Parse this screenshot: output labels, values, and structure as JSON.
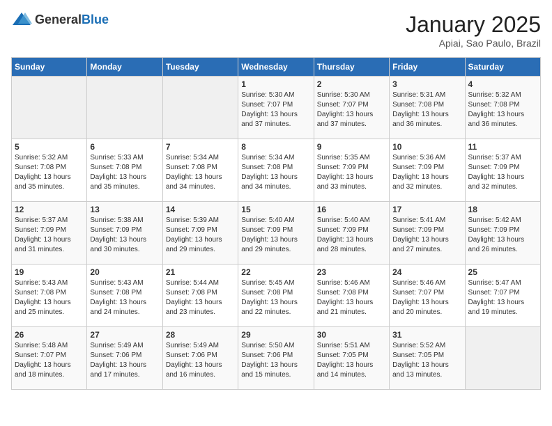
{
  "header": {
    "logo_general": "General",
    "logo_blue": "Blue",
    "title": "January 2025",
    "subtitle": "Apiai, Sao Paulo, Brazil"
  },
  "calendar": {
    "days_of_week": [
      "Sunday",
      "Monday",
      "Tuesday",
      "Wednesday",
      "Thursday",
      "Friday",
      "Saturday"
    ],
    "weeks": [
      [
        {
          "day": null,
          "sunrise": null,
          "sunset": null,
          "daylight": null
        },
        {
          "day": null,
          "sunrise": null,
          "sunset": null,
          "daylight": null
        },
        {
          "day": null,
          "sunrise": null,
          "sunset": null,
          "daylight": null
        },
        {
          "day": "1",
          "sunrise": "5:30 AM",
          "sunset": "7:07 PM",
          "daylight": "13 hours and 37 minutes."
        },
        {
          "day": "2",
          "sunrise": "5:30 AM",
          "sunset": "7:07 PM",
          "daylight": "13 hours and 37 minutes."
        },
        {
          "day": "3",
          "sunrise": "5:31 AM",
          "sunset": "7:08 PM",
          "daylight": "13 hours and 36 minutes."
        },
        {
          "day": "4",
          "sunrise": "5:32 AM",
          "sunset": "7:08 PM",
          "daylight": "13 hours and 36 minutes."
        }
      ],
      [
        {
          "day": "5",
          "sunrise": "5:32 AM",
          "sunset": "7:08 PM",
          "daylight": "13 hours and 35 minutes."
        },
        {
          "day": "6",
          "sunrise": "5:33 AM",
          "sunset": "7:08 PM",
          "daylight": "13 hours and 35 minutes."
        },
        {
          "day": "7",
          "sunrise": "5:34 AM",
          "sunset": "7:08 PM",
          "daylight": "13 hours and 34 minutes."
        },
        {
          "day": "8",
          "sunrise": "5:34 AM",
          "sunset": "7:08 PM",
          "daylight": "13 hours and 34 minutes."
        },
        {
          "day": "9",
          "sunrise": "5:35 AM",
          "sunset": "7:09 PM",
          "daylight": "13 hours and 33 minutes."
        },
        {
          "day": "10",
          "sunrise": "5:36 AM",
          "sunset": "7:09 PM",
          "daylight": "13 hours and 32 minutes."
        },
        {
          "day": "11",
          "sunrise": "5:37 AM",
          "sunset": "7:09 PM",
          "daylight": "13 hours and 32 minutes."
        }
      ],
      [
        {
          "day": "12",
          "sunrise": "5:37 AM",
          "sunset": "7:09 PM",
          "daylight": "13 hours and 31 minutes."
        },
        {
          "day": "13",
          "sunrise": "5:38 AM",
          "sunset": "7:09 PM",
          "daylight": "13 hours and 30 minutes."
        },
        {
          "day": "14",
          "sunrise": "5:39 AM",
          "sunset": "7:09 PM",
          "daylight": "13 hours and 29 minutes."
        },
        {
          "day": "15",
          "sunrise": "5:40 AM",
          "sunset": "7:09 PM",
          "daylight": "13 hours and 29 minutes."
        },
        {
          "day": "16",
          "sunrise": "5:40 AM",
          "sunset": "7:09 PM",
          "daylight": "13 hours and 28 minutes."
        },
        {
          "day": "17",
          "sunrise": "5:41 AM",
          "sunset": "7:09 PM",
          "daylight": "13 hours and 27 minutes."
        },
        {
          "day": "18",
          "sunrise": "5:42 AM",
          "sunset": "7:09 PM",
          "daylight": "13 hours and 26 minutes."
        }
      ],
      [
        {
          "day": "19",
          "sunrise": "5:43 AM",
          "sunset": "7:08 PM",
          "daylight": "13 hours and 25 minutes."
        },
        {
          "day": "20",
          "sunrise": "5:43 AM",
          "sunset": "7:08 PM",
          "daylight": "13 hours and 24 minutes."
        },
        {
          "day": "21",
          "sunrise": "5:44 AM",
          "sunset": "7:08 PM",
          "daylight": "13 hours and 23 minutes."
        },
        {
          "day": "22",
          "sunrise": "5:45 AM",
          "sunset": "7:08 PM",
          "daylight": "13 hours and 22 minutes."
        },
        {
          "day": "23",
          "sunrise": "5:46 AM",
          "sunset": "7:08 PM",
          "daylight": "13 hours and 21 minutes."
        },
        {
          "day": "24",
          "sunrise": "5:46 AM",
          "sunset": "7:07 PM",
          "daylight": "13 hours and 20 minutes."
        },
        {
          "day": "25",
          "sunrise": "5:47 AM",
          "sunset": "7:07 PM",
          "daylight": "13 hours and 19 minutes."
        }
      ],
      [
        {
          "day": "26",
          "sunrise": "5:48 AM",
          "sunset": "7:07 PM",
          "daylight": "13 hours and 18 minutes."
        },
        {
          "day": "27",
          "sunrise": "5:49 AM",
          "sunset": "7:06 PM",
          "daylight": "13 hours and 17 minutes."
        },
        {
          "day": "28",
          "sunrise": "5:49 AM",
          "sunset": "7:06 PM",
          "daylight": "13 hours and 16 minutes."
        },
        {
          "day": "29",
          "sunrise": "5:50 AM",
          "sunset": "7:06 PM",
          "daylight": "13 hours and 15 minutes."
        },
        {
          "day": "30",
          "sunrise": "5:51 AM",
          "sunset": "7:05 PM",
          "daylight": "13 hours and 14 minutes."
        },
        {
          "day": "31",
          "sunrise": "5:52 AM",
          "sunset": "7:05 PM",
          "daylight": "13 hours and 13 minutes."
        },
        {
          "day": null,
          "sunrise": null,
          "sunset": null,
          "daylight": null
        }
      ]
    ]
  }
}
